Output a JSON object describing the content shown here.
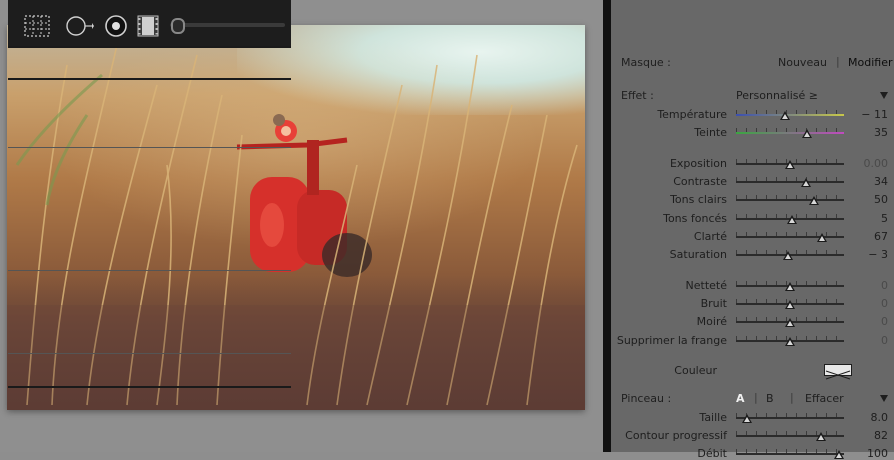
{
  "masque": {
    "label": "Masque :",
    "nouveau": "Nouveau",
    "modifier": "Modifier"
  },
  "effet": {
    "label": "Effet :",
    "preset": "Personnalisé ≥"
  },
  "sliders_wb": [
    {
      "label": "Température",
      "value": "− 11",
      "pos": 0.45,
      "color": "wb-temp"
    },
    {
      "label": "Teinte",
      "value": "35",
      "pos": 0.66,
      "color": "wb-tint"
    }
  ],
  "sliders_tone": [
    {
      "label": "Exposition",
      "value": "0.00",
      "pos": 0.5,
      "dim": true
    },
    {
      "label": "Contraste",
      "value": "34",
      "pos": 0.65
    },
    {
      "label": "Tons clairs",
      "value": "50",
      "pos": 0.72
    },
    {
      "label": "Tons foncés",
      "value": "5",
      "pos": 0.52
    },
    {
      "label": "Clarté",
      "value": "67",
      "pos": 0.8
    },
    {
      "label": "Saturation",
      "value": "− 3",
      "pos": 0.48
    }
  ],
  "sliders_detail": [
    {
      "label": "Netteté",
      "value": "0",
      "pos": 0.5,
      "dim": true
    },
    {
      "label": "Bruit",
      "value": "0",
      "pos": 0.5,
      "dim": true
    },
    {
      "label": "Moiré",
      "value": "0",
      "pos": 0.5,
      "dim": true
    },
    {
      "label": "Supprimer la frange",
      "value": "0",
      "pos": 0.5,
      "dim": true
    }
  ],
  "couleur": {
    "label": "Couleur"
  },
  "pinceau": {
    "label": "Pinceau :",
    "a": "A",
    "b": "B",
    "effacer": "Effacer"
  },
  "sliders_brush": [
    {
      "label": "Taille",
      "value": "8.0",
      "pos": 0.1
    },
    {
      "label": "Contour progressif",
      "value": "82",
      "pos": 0.79
    },
    {
      "label": "Débit",
      "value": "100",
      "pos": 0.95
    }
  ],
  "icons": {
    "tool1": "marquee-grid-icon",
    "tool2": "circle-arrow-icon",
    "tool3": "radio-dot-icon",
    "tool4": "film-strip-icon"
  },
  "colors": {
    "panel_bg": "#686868",
    "toolstrip_bg": "#1d1d1d",
    "text": "#1e1e1e"
  }
}
